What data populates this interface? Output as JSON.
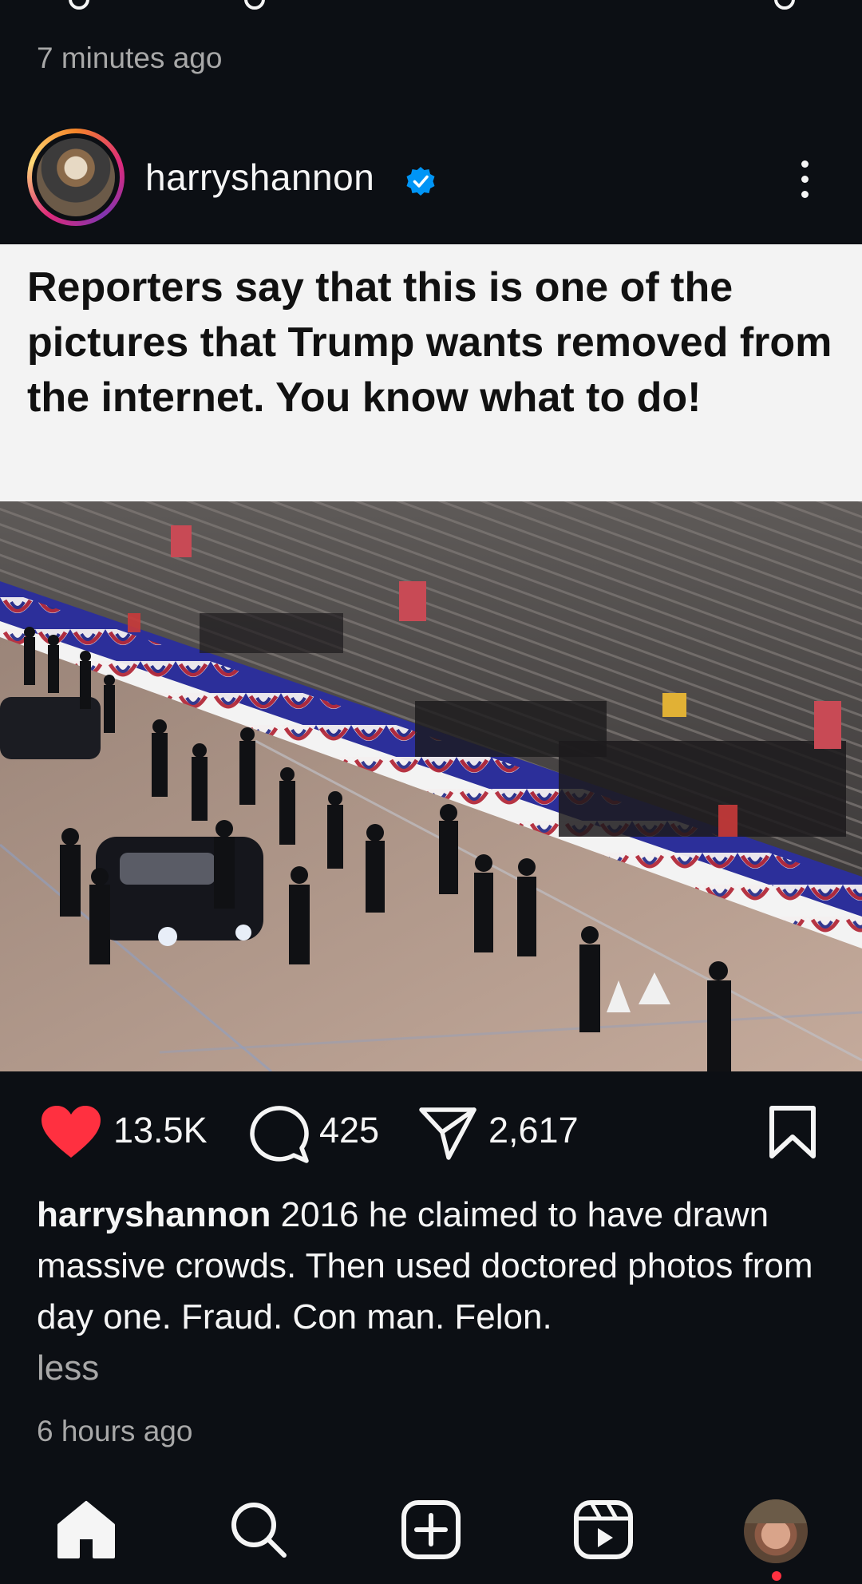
{
  "previous_post": {
    "time": "7 minutes ago"
  },
  "post": {
    "username": "harryshannon",
    "verified": true,
    "image_caption_text": "Reporters say that this is one of the pictures that Trump wants removed from the internet. You know what to do!",
    "likes": "13.5K",
    "comments": "425",
    "shares": "2,617",
    "caption_user": "harryshannon",
    "caption_text": " 2016 he claimed to have drawn massive crowds. Then used doctored photos from day one. Fraud. Con man. Felon.",
    "caption_toggle": "less",
    "time": "6 hours ago"
  },
  "icons": {
    "like": "heart-filled-icon",
    "comment": "comment-bubble-icon",
    "share": "paper-plane-icon",
    "save": "bookmark-icon",
    "verified": "verified-badge-icon",
    "more": "more-vertical-icon"
  },
  "colors": {
    "background": "#0c0f14",
    "like_red": "#ff3040",
    "verified_blue": "#0095f6",
    "muted_text": "#a8a8a8"
  },
  "bottom_nav": [
    {
      "name": "home"
    },
    {
      "name": "search"
    },
    {
      "name": "create"
    },
    {
      "name": "reels"
    },
    {
      "name": "profile"
    }
  ]
}
